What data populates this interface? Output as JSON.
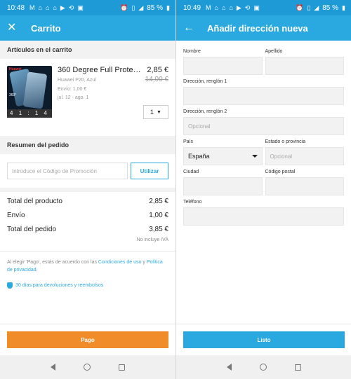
{
  "status_left": {
    "time": "10:48",
    "battery": "85 %"
  },
  "status_right": {
    "time": "10:49",
    "battery": "85 %"
  },
  "cart": {
    "title": "Carrito",
    "items_header": "Artículos en el carrito",
    "item": {
      "name": "360 Degree Full Protec…",
      "price": "2,85 €",
      "old_price": "14,00 €",
      "variant": "Huawei P20, Azul",
      "shipping": "Envío: 1,00 €",
      "delivery": "jul. 12 - ago. 1",
      "quantity": "1",
      "timer": "4 1 : 1 4",
      "image_brand": "Huawei",
      "image_text": "360°"
    },
    "summary_header": "Resumen del pedido",
    "promo_placeholder": "Introduce el Código de Promoción",
    "promo_button": "Utilizar",
    "totals": {
      "product_label": "Total del producto",
      "product_value": "2,85 €",
      "shipping_label": "Envío",
      "shipping_value": "1,00 €",
      "order_label": "Total del pedido",
      "order_value": "3,85 €",
      "vat_note": "No incluye IVA"
    },
    "terms_prefix": "Al elegir 'Pago', estás de acuerdo con las ",
    "terms_link": "Condiciones de uso",
    "terms_mid": " y ",
    "privacy_link": "Política de privacidad",
    "terms_suffix": ".",
    "returns": "30 días para devoluciones y reembolsos",
    "pay_button": "Pago"
  },
  "address": {
    "title": "Añadir dirección nueva",
    "first_name_label": "Nombre",
    "last_name_label": "Apellido",
    "line1_label": "Dirección, renglón 1",
    "line2_label": "Dirección, renglón 2",
    "line2_placeholder": "Opcional",
    "country_label": "País",
    "country_value": "España",
    "state_label": "Estado o provincia",
    "state_placeholder": "Opcional",
    "city_label": "Ciudad",
    "zip_label": "Código postal",
    "phone_label": "Teléfono",
    "done_button": "Listo"
  },
  "colors": {
    "header": "#2aa8e0",
    "pay": "#f08c2a",
    "link": "#2aa8e0"
  }
}
